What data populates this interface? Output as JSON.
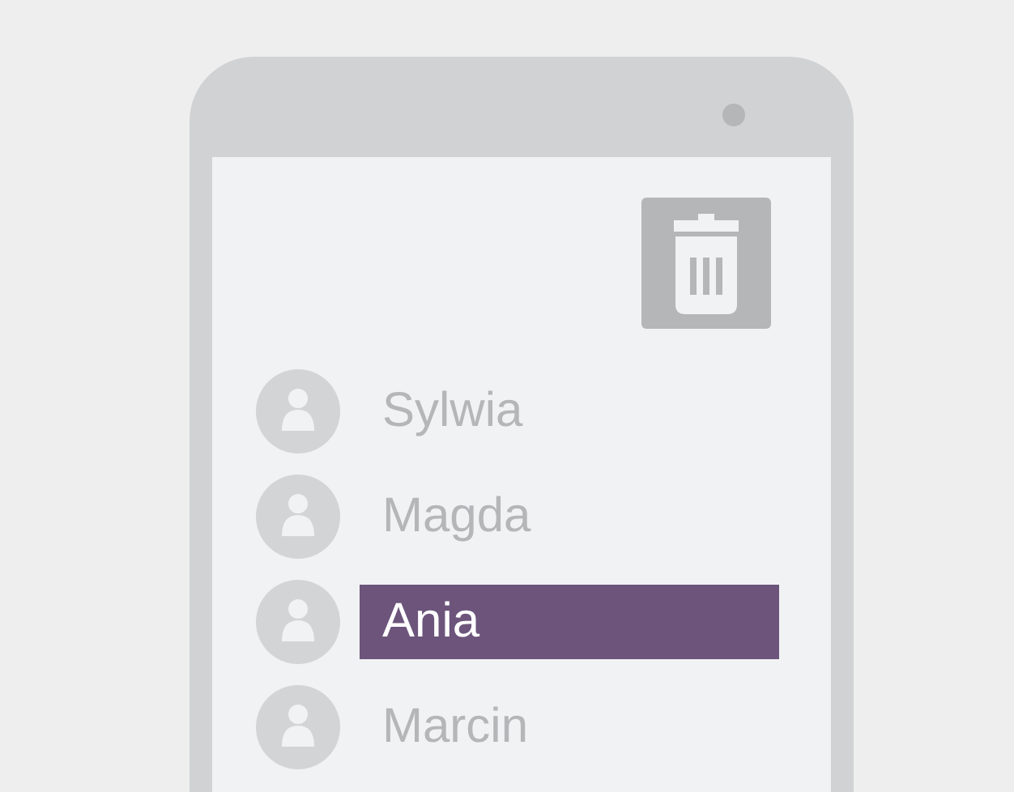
{
  "contacts": [
    {
      "name": "Sylwia",
      "selected": false
    },
    {
      "name": "Magda",
      "selected": false
    },
    {
      "name": "Ania",
      "selected": true
    },
    {
      "name": "Marcin",
      "selected": false
    }
  ]
}
